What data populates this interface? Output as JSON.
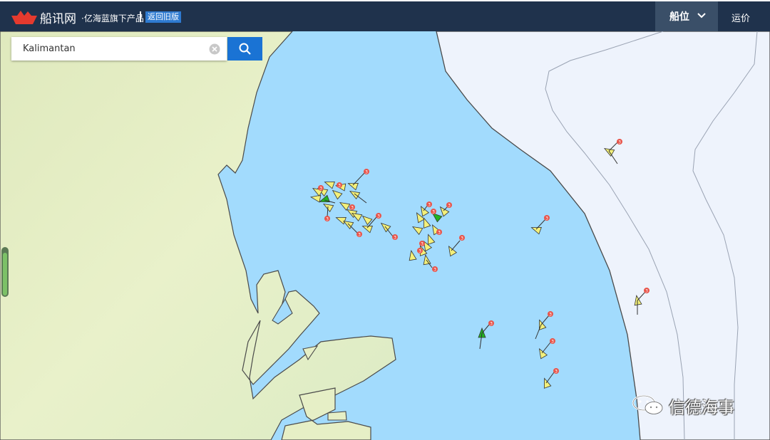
{
  "header": {
    "brand": "船讯网",
    "tagline": "·亿海蓝旗下产品",
    "old_version": "返回旧版",
    "tabs": [
      {
        "label": "船位",
        "active": true
      },
      {
        "label": "运价",
        "active": false
      }
    ],
    "colors": {
      "bar": "#1f324c",
      "active_tab": "#3a4f68",
      "badge": "#2e7ad0"
    }
  },
  "search": {
    "value": "Kalimantan",
    "placeholder": "",
    "icons": [
      "clear-icon",
      "search-icon"
    ],
    "button_color": "#1a73d4"
  },
  "map": {
    "colors": {
      "water": "#a2dbfd",
      "land": "#e6efc6",
      "shore": "#4a4a4a",
      "offshore": "#eef3fc"
    },
    "ship_badge": "3",
    "ship_colors": {
      "default": "#f3f07a",
      "highlight": "#22b422",
      "badge": "#e8544a"
    },
    "ships": [
      {
        "c": "#f3f07a"
      },
      {
        "c": "#f3f07a"
      },
      {
        "c": "#f3f07a"
      },
      {
        "c": "#22b422"
      },
      {
        "c": "#f3f07a"
      },
      {
        "c": "#f3f07a",
        "b": true
      },
      {
        "c": "#f3f07a",
        "b": true
      },
      {
        "c": "#f3f07a"
      },
      {
        "c": "#f3f07a"
      },
      {
        "c": "#f3f07a",
        "b": true
      },
      {
        "c": "#f3f07a",
        "b": true
      },
      {
        "c": "#f3f07a"
      },
      {
        "c": "#f3f07a",
        "b": true
      },
      {
        "c": "#f3f07a"
      },
      {
        "c": "#f3f07a",
        "b": true
      },
      {
        "c": "#f3f07a"
      },
      {
        "c": "#f3f07a",
        "b": true
      },
      {
        "c": "#f3f07a",
        "b": true
      },
      {
        "c": "#f3f07a"
      },
      {
        "c": "#f3f07a"
      },
      {
        "c": "#f3f07a",
        "b": true
      },
      {
        "c": "#f3f07a",
        "b": true
      },
      {
        "c": "#22b422",
        "b": true
      },
      {
        "c": "#f3f07a"
      },
      {
        "c": "#f3f07a",
        "b": true
      },
      {
        "c": "#f3f07a"
      },
      {
        "c": "#f3f07a",
        "b": true
      },
      {
        "c": "#f3f07a",
        "b": true
      },
      {
        "c": "#f3f07a"
      },
      {
        "c": "#f3f07a",
        "b": true
      },
      {
        "c": "#f3f07a",
        "b": true
      },
      {
        "c": "#f3f07a",
        "b": true
      },
      {
        "c": "#f3f07a",
        "b": true
      },
      {
        "c": "#f3f07a",
        "b": true
      },
      {
        "c": "#f3f07a",
        "b": true
      },
      {
        "c": "#22b422",
        "b": true
      },
      {
        "c": "#f3f07a",
        "b": true
      },
      {
        "c": "#f3f07a",
        "b": true
      },
      {
        "c": "#f3f07a",
        "b": true
      }
    ]
  },
  "watermark": {
    "text": "信德海事",
    "icon": "wechat-icon"
  }
}
